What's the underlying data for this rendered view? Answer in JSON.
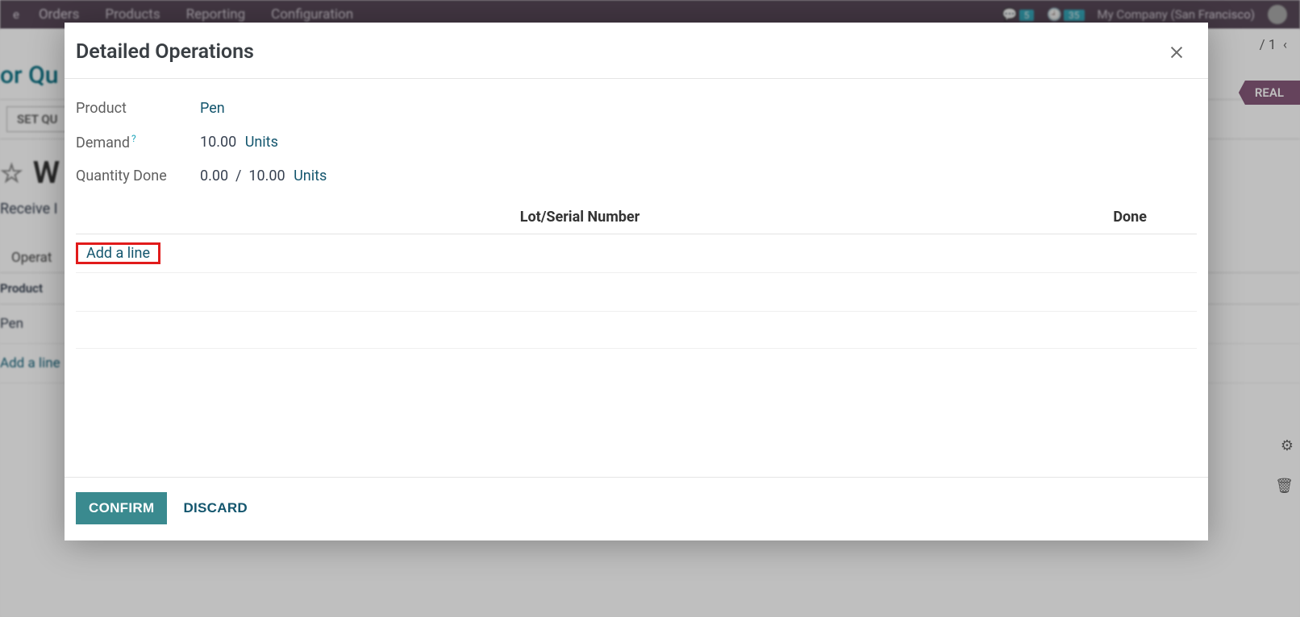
{
  "header": {
    "menu": [
      "Orders",
      "Products",
      "Reporting",
      "Configuration"
    ],
    "msg_badge": "5",
    "clock_badge": "35",
    "company": "My Company (San Francisco)"
  },
  "bg": {
    "breadcrumb": "or Qu",
    "btn_setq": "SET QU",
    "title": "W",
    "receive_label": "Receive I",
    "tab_operations": "Operat",
    "product_col": "Product",
    "product_row": "Pen",
    "bg_add_line": "Add a line",
    "stage": "REAL",
    "pager": " / 1"
  },
  "modal": {
    "title": "Detailed Operations",
    "labels": {
      "product": "Product",
      "demand": "Demand",
      "qty_done": "Quantity Done"
    },
    "values": {
      "product": "Pen",
      "demand_qty": "10.00",
      "demand_uom": "Units",
      "done_qty": "0.00",
      "done_sep": "/",
      "done_total": "10.00",
      "done_uom": "Units"
    },
    "table": {
      "col_lot": "Lot/Serial Number",
      "col_done": "Done",
      "add_line": "Add a line"
    },
    "buttons": {
      "confirm": "CONFIRM",
      "discard": "DISCARD"
    }
  }
}
